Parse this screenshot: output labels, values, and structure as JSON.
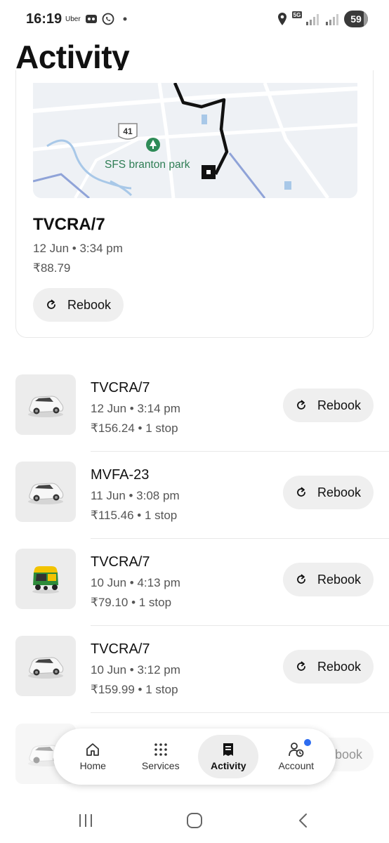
{
  "status_bar": {
    "time": "16:19",
    "app_mini": "Uber",
    "network": "5G",
    "battery": "59",
    "icons": [
      "voicemail-icon",
      "whatsapp-icon",
      "location-icon",
      "signal-icon",
      "signal-icon"
    ]
  },
  "page": {
    "title": "Activity"
  },
  "featured": {
    "map": {
      "road_badge": "41",
      "place_label": "SFS branton park"
    },
    "title": "TVCRA/7",
    "meta": "12 Jun • 3:34 pm",
    "price": "₹88.79",
    "rebook_label": "Rebook"
  },
  "trips": [
    {
      "title": "TVCRA/7",
      "meta": "12 Jun • 3:14 pm",
      "price": "₹156.24 • 1 stop",
      "vehicle": "car-icon",
      "rebook_label": "Rebook"
    },
    {
      "title": "MVFA-23",
      "meta": "11 Jun • 3:08 pm",
      "price": "₹115.46 • 1 stop",
      "vehicle": "car-icon",
      "rebook_label": "Rebook"
    },
    {
      "title": "TVCRA/7",
      "meta": "10 Jun • 4:13 pm",
      "price": "₹79.10 • 1 stop",
      "vehicle": "auto-rickshaw-icon",
      "rebook_label": "Rebook"
    },
    {
      "title": "TVCRA/7",
      "meta": "10 Jun • 3:12 pm",
      "price": "₹159.99 • 1 stop",
      "vehicle": "car-icon",
      "rebook_label": "Rebook"
    }
  ],
  "partial_row": {
    "rebook_fragment": "book"
  },
  "bottom_nav": {
    "items": [
      {
        "label": "Home",
        "icon": "home-icon"
      },
      {
        "label": "Services",
        "icon": "grid-icon"
      },
      {
        "label": "Activity",
        "icon": "receipt-icon",
        "active": true
      },
      {
        "label": "Account",
        "icon": "account-icon",
        "badge": true
      }
    ],
    "badge_color": "#2d6cf0"
  }
}
